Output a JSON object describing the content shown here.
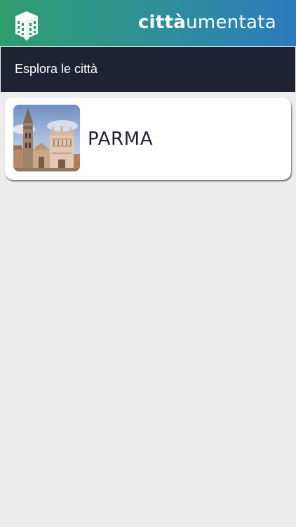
{
  "header": {
    "brand_bold": "città",
    "brand_light": "umentata",
    "logo_icon": "building-ar-icon"
  },
  "section": {
    "title": "Esplora le città"
  },
  "cities": [
    {
      "name": "PARMA",
      "image_icon": "parma-cathedral-baptistery-photo"
    }
  ]
}
